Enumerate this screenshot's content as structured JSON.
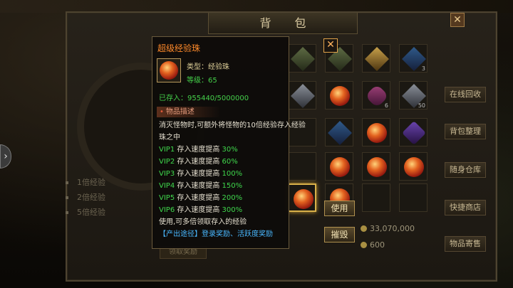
{
  "top_bar": {
    "left_text": "背 包"
  },
  "bag": {
    "title": "背 包",
    "close_glyph": "✕"
  },
  "left_panel": {
    "lines": [
      "1倍经验",
      "2倍经验",
      "5倍经验"
    ],
    "claim_button": "领取奖励"
  },
  "right_buttons": [
    "在线回收",
    "背包整理",
    "随身仓库",
    "快捷商店",
    "物品寄售"
  ],
  "money": {
    "gold": "33,070,000",
    "ingot": "600"
  },
  "tooltip": {
    "name": "超级经验珠",
    "type_label": "类型：经验珠",
    "level_label": "等级：65",
    "stored_label": "已存入：955440/5000000",
    "desc_header": "物品描述",
    "desc_line1": "消灭怪物时,可额外将怪物的10倍经验存入经验",
    "desc_line2": "珠之中",
    "vip": [
      {
        "tag": "VIP1",
        "text": " 存入速度提高 ",
        "val": "30%"
      },
      {
        "tag": "VIP2",
        "text": " 存入速度提高 ",
        "val": "60%"
      },
      {
        "tag": "VIP3",
        "text": " 存入速度提高 ",
        "val": "100%"
      },
      {
        "tag": "VIP4",
        "text": " 存入速度提高 ",
        "val": "150%"
      },
      {
        "tag": "VIP5",
        "text": " 存入速度提高 ",
        "val": "200%"
      },
      {
        "tag": "VIP6",
        "text": " 存入速度提高 ",
        "val": "300%"
      }
    ],
    "use_note": "使用,可多倍领取存入的经验",
    "source_tag": "【产出途径】",
    "source_text": "登录奖励、活跃度奖励",
    "close_glyph": "✕"
  },
  "actions": {
    "use": "使用",
    "destroy": "摧毁"
  },
  "slots": [
    {
      "kind": "gear",
      "count": ""
    },
    {
      "kind": "gear",
      "count": ""
    },
    {
      "kind": "gold",
      "count": ""
    },
    {
      "kind": "blue",
      "count": "3"
    },
    {
      "kind": "silver",
      "count": ""
    },
    {
      "kind": "orb",
      "count": ""
    },
    {
      "kind": "pink",
      "count": "6"
    },
    {
      "kind": "silver",
      "count": "50"
    },
    {
      "kind": "empty",
      "count": ""
    },
    {
      "kind": "blue",
      "count": ""
    },
    {
      "kind": "orb",
      "count": ""
    },
    {
      "kind": "purple",
      "count": ""
    },
    {
      "kind": "empty",
      "count": ""
    },
    {
      "kind": "orb",
      "count": ""
    },
    {
      "kind": "orb",
      "count": ""
    },
    {
      "kind": "orb",
      "count": ""
    },
    {
      "kind": "orb",
      "count": ""
    },
    {
      "kind": "orb",
      "count": ""
    },
    {
      "kind": "empty",
      "count": ""
    },
    {
      "kind": "empty",
      "count": ""
    }
  ]
}
